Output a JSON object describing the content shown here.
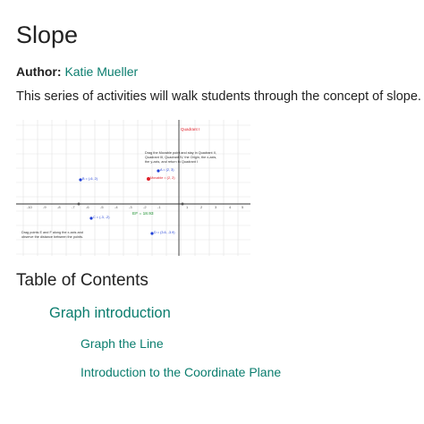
{
  "page": {
    "title": "Slope",
    "author_label": "Author:",
    "author_name": "Katie Mueller",
    "description": "This series of activities will walk students through the concept of slope."
  },
  "thumbnail": {
    "quadrant_label": "Quadrant I",
    "instructions": [
      "Drag the Movable point and stay in Quadrant II,",
      "Quadrant III, Quadrant IV, the Origin, the x-axis,",
      "the y-axis, and return to Quadrant I"
    ],
    "point_a": "A = (2, 3)",
    "point_movable": "Movable = (2, 2)",
    "point_b": "B = (-6, 2)",
    "point_c": "C = (-3, -2)",
    "point_d": "D = (3.6, -3.9)",
    "ef_label": "EF = 18.93",
    "drag_note": [
      "Drag points E and F along the x-axis and",
      "observe the distance between the points."
    ],
    "colors": {
      "point_blue": "#1f3fd6",
      "point_red": "#e0202a",
      "green": "#1a8f2e",
      "grid": "#dddddd"
    }
  },
  "toc": {
    "heading": "Table of Contents",
    "items": [
      {
        "label": "Graph introduction"
      },
      {
        "label": "Graph the Line"
      },
      {
        "label": "Introduction to the Coordinate Plane"
      }
    ]
  },
  "colors": {
    "link": "#0a7d6e",
    "text": "#222222"
  }
}
